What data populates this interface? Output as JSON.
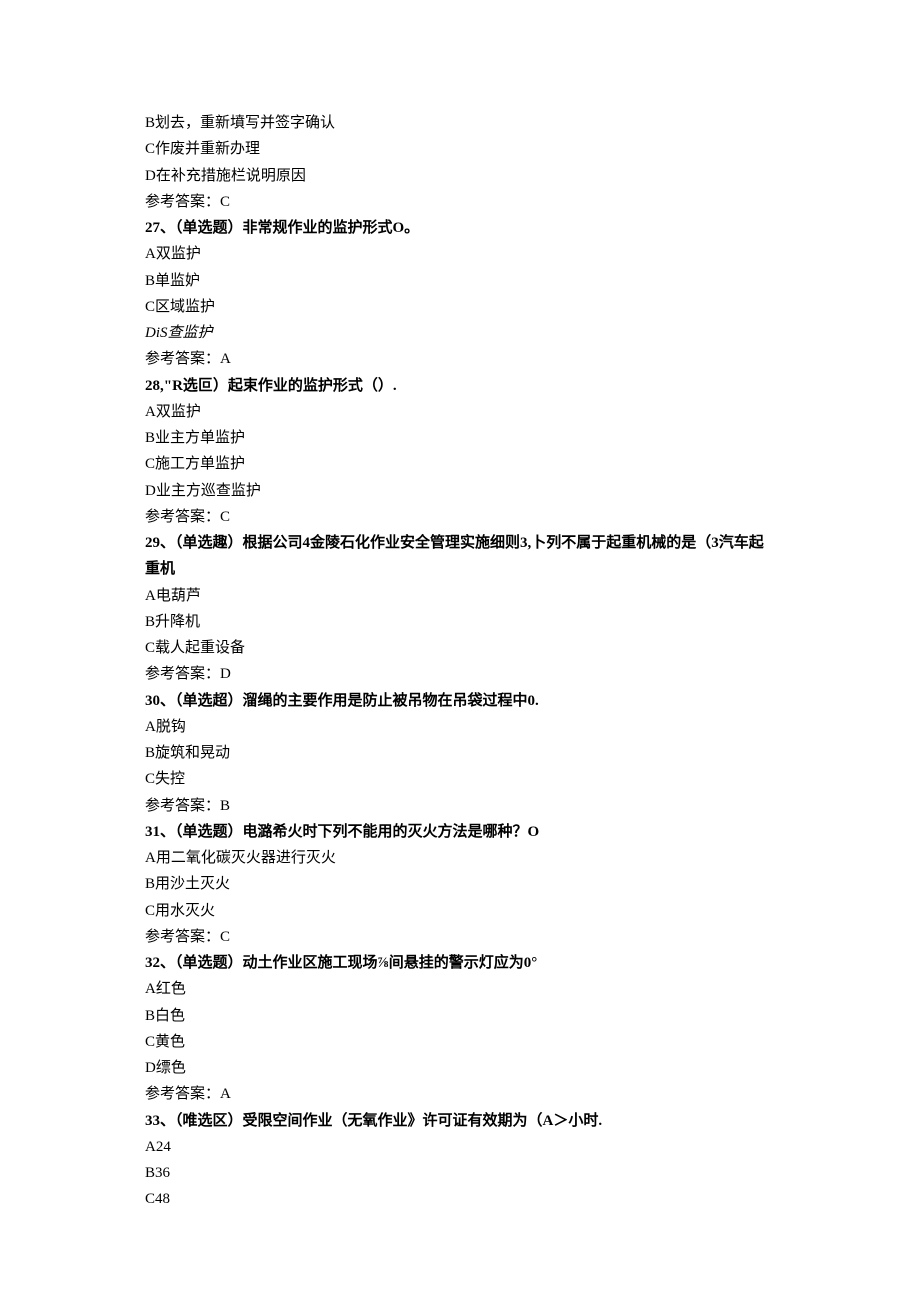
{
  "lines": [
    {
      "text": "B划去，重新墳写并签字确认",
      "style": ""
    },
    {
      "text": "C作废并重新办理",
      "style": ""
    },
    {
      "text": "D在补充措施栏说明原因",
      "style": ""
    },
    {
      "text": "参考答案：C",
      "style": ""
    },
    {
      "text": "27、（单选题）非常规作业的监护形式O。",
      "style": "bold"
    },
    {
      "text": "A双监护",
      "style": ""
    },
    {
      "text": "B单监妒",
      "style": ""
    },
    {
      "text": "C区域监护",
      "style": ""
    },
    {
      "text": "DiS查监护",
      "style": "italic"
    },
    {
      "text": "参考答案：A",
      "style": ""
    },
    {
      "text": "28,\"R选叵）起束作业的监护形式（）.",
      "style": "bold"
    },
    {
      "text": "A双监护",
      "style": ""
    },
    {
      "text": "B业主方单监护",
      "style": ""
    },
    {
      "text": "C施工方单监护",
      "style": ""
    },
    {
      "text": "D业主方巡查监护",
      "style": ""
    },
    {
      "text": "参考答案：C",
      "style": ""
    },
    {
      "text": "29、（单选趣）根据公司4金陵石化作业安全管理实施细则3,卜列不属于起重机械的是（3汽车起重机",
      "style": "bold"
    },
    {
      "text": "A电葫芦",
      "style": ""
    },
    {
      "text": "B升降机",
      "style": ""
    },
    {
      "text": "C载人起重设备",
      "style": ""
    },
    {
      "text": "参考答案：D",
      "style": ""
    },
    {
      "text": "30、（单选超）溜绳的主要作用是防止被吊物在吊袋过程中0.",
      "style": "bold"
    },
    {
      "text": "A脱钩",
      "style": ""
    },
    {
      "text": "B旋筑和晃动",
      "style": ""
    },
    {
      "text": "C失控",
      "style": ""
    },
    {
      "text": "参考答案：B",
      "style": ""
    },
    {
      "text": "31、（单选题）电潞希火时下列不能用的灭火方法是哪种？O",
      "style": "bold"
    },
    {
      "text": "A用二氧化碳灭火器进行灭火",
      "style": ""
    },
    {
      "text": "B用沙土灭火",
      "style": ""
    },
    {
      "text": "C用水灭火",
      "style": ""
    },
    {
      "text": "参考答案：C",
      "style": ""
    },
    {
      "text": "32、（单选题）动土作业区施工现场⅞间悬挂的警示灯应为0°",
      "style": "bold"
    },
    {
      "text": "A红色",
      "style": ""
    },
    {
      "text": "B白色",
      "style": ""
    },
    {
      "text": "C黄色",
      "style": ""
    },
    {
      "text": "D缥色",
      "style": ""
    },
    {
      "text": "参考答案：A",
      "style": ""
    },
    {
      "text": "33、（唯选区）受限空间作业（无氧作业》许可证有效期为（A＞小时.",
      "style": "bold"
    },
    {
      "text": "A24",
      "style": ""
    },
    {
      "text": "B36",
      "style": ""
    },
    {
      "text": "C48",
      "style": ""
    }
  ]
}
